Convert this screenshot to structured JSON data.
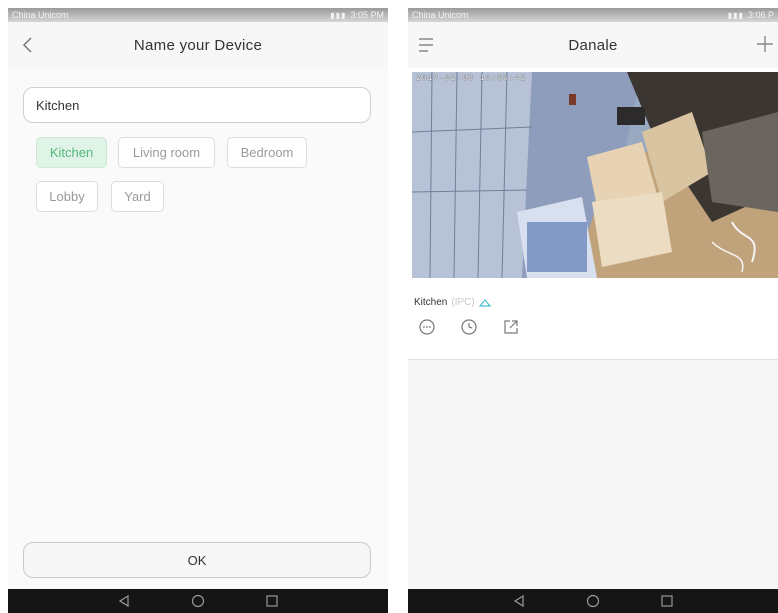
{
  "left_screen": {
    "status": {
      "carrier": "China Unicom",
      "time": "3:05 PM"
    },
    "title": "Name your Device",
    "name_input": {
      "value": "Kitchen"
    },
    "suggestions": [
      {
        "label": "Kitchen",
        "selected": true
      },
      {
        "label": "Living room",
        "selected": false
      },
      {
        "label": "Bedroom",
        "selected": false
      },
      {
        "label": "Lobby",
        "selected": false
      },
      {
        "label": "Yard",
        "selected": false
      }
    ],
    "ok_label": "OK"
  },
  "right_screen": {
    "status": {
      "carrier": "China Unicom",
      "time": "3:06 P"
    },
    "title": "Danale",
    "camera": {
      "timestamp": "2017-02-08 15:06:42",
      "device_name": "Kitchen",
      "device_type": "(IPC)"
    }
  },
  "icons": {
    "back": "chevron-left-icon",
    "menu": "hamburger-menu-icon",
    "add": "plus-icon",
    "cloud": "cloud-icon",
    "message": "message-icon",
    "playback": "clock-icon",
    "share": "share-icon",
    "sys_back": "triangle-back-icon",
    "sys_home": "circle-home-icon",
    "sys_recent": "square-recent-icon"
  },
  "colors": {
    "accent_green": "#55b87f",
    "selected_tag_bg": "#dff3e6",
    "cloud_accent": "#4bbfd9"
  }
}
